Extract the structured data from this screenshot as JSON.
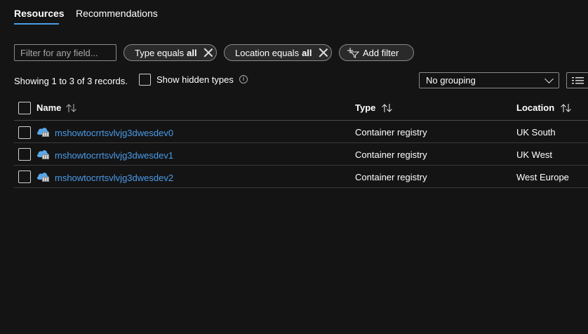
{
  "tabs": [
    {
      "label": "Resources",
      "active": true
    },
    {
      "label": "Recommendations",
      "active": false
    }
  ],
  "filter": {
    "placeholder": "Filter for any field..."
  },
  "pills": [
    {
      "prefix": "Type equals",
      "value": "all"
    },
    {
      "prefix": "Location equals",
      "value": "all"
    }
  ],
  "add_filter_label": "Add filter",
  "records_text": "Showing 1 to 3 of 3 records.",
  "show_hidden_label": "Show hidden types",
  "info_glyph": "i",
  "grouping": {
    "selected": "No grouping"
  },
  "table": {
    "columns": [
      "Name",
      "Type",
      "Location"
    ],
    "rows": [
      {
        "name": "mshowtocrrtsvlvjg3dwesdev0",
        "type": "Container registry",
        "location": "UK South"
      },
      {
        "name": "mshowtocrrtsvlvjg3dwesdev1",
        "type": "Container registry",
        "location": "UK West"
      },
      {
        "name": "mshowtocrrtsvlvjg3dwesdev2",
        "type": "Container registry",
        "location": "West Europe"
      }
    ]
  },
  "colors": {
    "accent": "#4a9be8",
    "background": "#141414",
    "border": "#8a8a8a"
  },
  "icons": {
    "resource": "container-registry-icon",
    "sort": "sort-arrows-icon",
    "add_filter": "add-filter-icon",
    "view": "list-view-icon"
  }
}
